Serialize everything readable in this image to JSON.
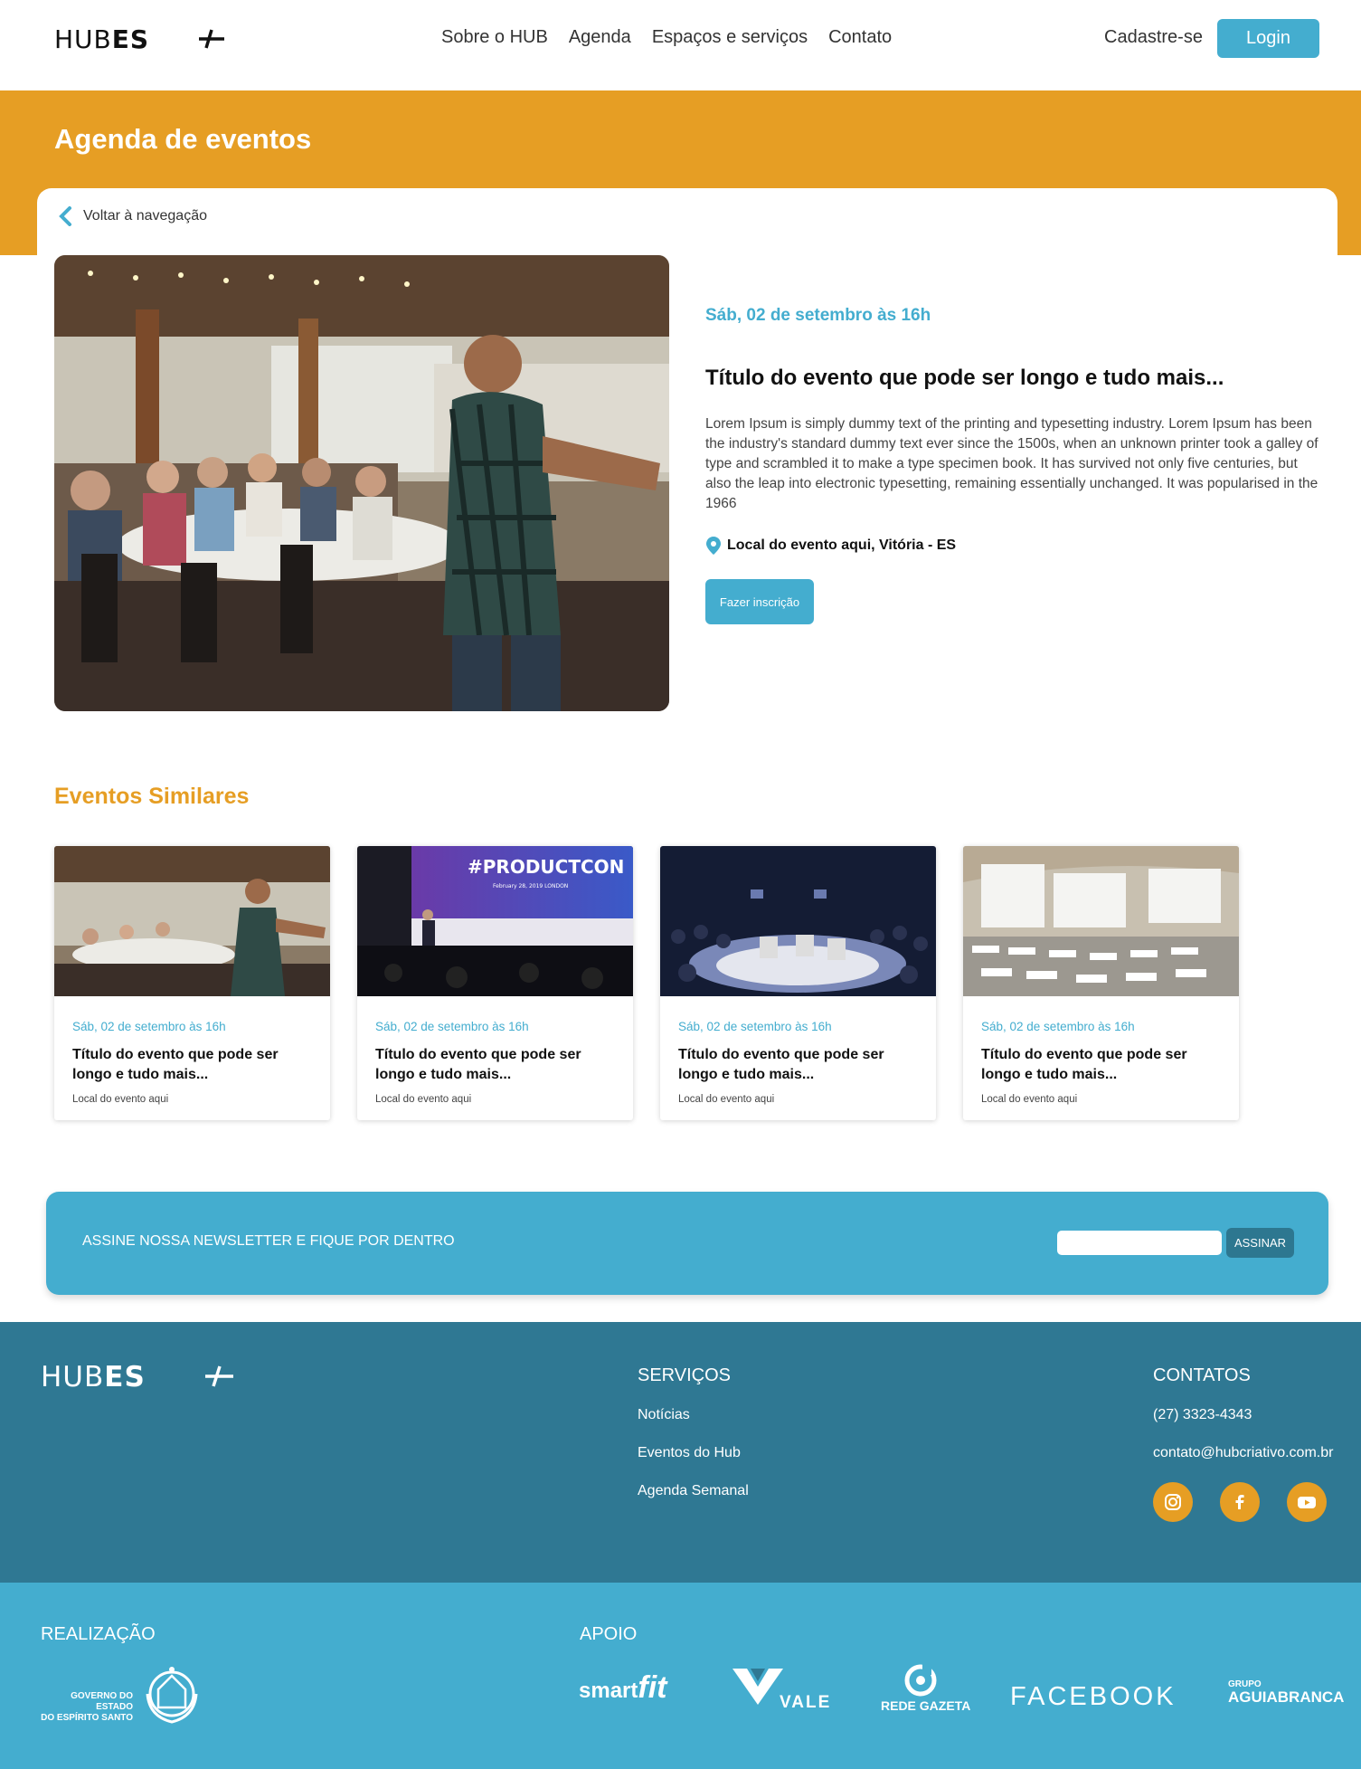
{
  "header": {
    "logo_text": "HUBES+",
    "nav": [
      "Sobre o HUB",
      "Agenda",
      "Espaços e serviços",
      "Contato"
    ],
    "signup_label": "Cadastre-se",
    "login_label": "Login"
  },
  "page_title": "Agenda de eventos",
  "back_label": "Voltar à navegação",
  "event": {
    "date": "Sáb, 02 de setembro às 16h",
    "title": "Título do evento que pode ser longo e tudo mais...",
    "description": "Lorem Ipsum is simply dummy text of the printing and typesetting industry. Lorem Ipsum has been the industry's standard dummy text ever since the 1500s, when an unknown printer took a galley of type and scrambled it to make a type specimen book. It has survived not only five centuries, but also the leap into electronic typesetting, remaining essentially unchanged. It was popularised in the 1966",
    "location": "Local do evento aqui, Vitória - ES",
    "enroll_label": "Fazer inscrição"
  },
  "similar": {
    "title": "Eventos Similares",
    "cards": [
      {
        "date": "Sáb, 02 de setembro às 16h",
        "title": "Título do evento que pode ser longo e tudo mais...",
        "location": "Local do evento aqui"
      },
      {
        "date": "Sáb, 02 de setembro às 16h",
        "title": "Título do evento que pode ser longo e tudo mais...",
        "location": "Local do evento aqui",
        "image_text": "#PRODUCTCON",
        "image_subtext": "February 28, 2019    LONDON"
      },
      {
        "date": "Sáb, 02 de setembro às 16h",
        "title": "Título do evento que pode ser longo e tudo mais...",
        "location": "Local do evento aqui"
      },
      {
        "date": "Sáb, 02 de setembro às 16h",
        "title": "Título do evento que pode ser longo e tudo mais...",
        "location": "Local do evento aqui"
      }
    ]
  },
  "newsletter": {
    "text": "ASSINE NOSSA NEWSLETTER E FIQUE POR DENTRO",
    "input_value": "",
    "button_label": "ASSINAR"
  },
  "footer": {
    "logo_text": "HUBES+",
    "services_title": "SERVIÇOS",
    "services": [
      "Notícias",
      "Eventos do Hub",
      "Agenda Semanal"
    ],
    "contacts_title": "CONTATOS",
    "phone": "(27) 3323-4343",
    "email": "contato@hubcriativo.com.br",
    "social_icons": [
      "instagram-icon",
      "facebook-icon",
      "youtube-icon"
    ]
  },
  "sponsors": {
    "realizacao_title": "REALIZAÇÃO",
    "governo_text": [
      "GOVERNO DO ESTADO",
      "DO ESPÍRITO SANTO"
    ],
    "apoio_title": "APOIO",
    "logos": {
      "smartfit": [
        "smart",
        "fit"
      ],
      "vale": "VALE",
      "gazeta": "REDE GAZETA",
      "facebook": "FACEBOOK",
      "aguiabranca": [
        "GRUPO",
        "AGUIABRANCA"
      ]
    }
  },
  "colors": {
    "accent_blue": "#44adcf",
    "accent_orange": "#e69e24",
    "footer_dark": "#2f7893"
  }
}
